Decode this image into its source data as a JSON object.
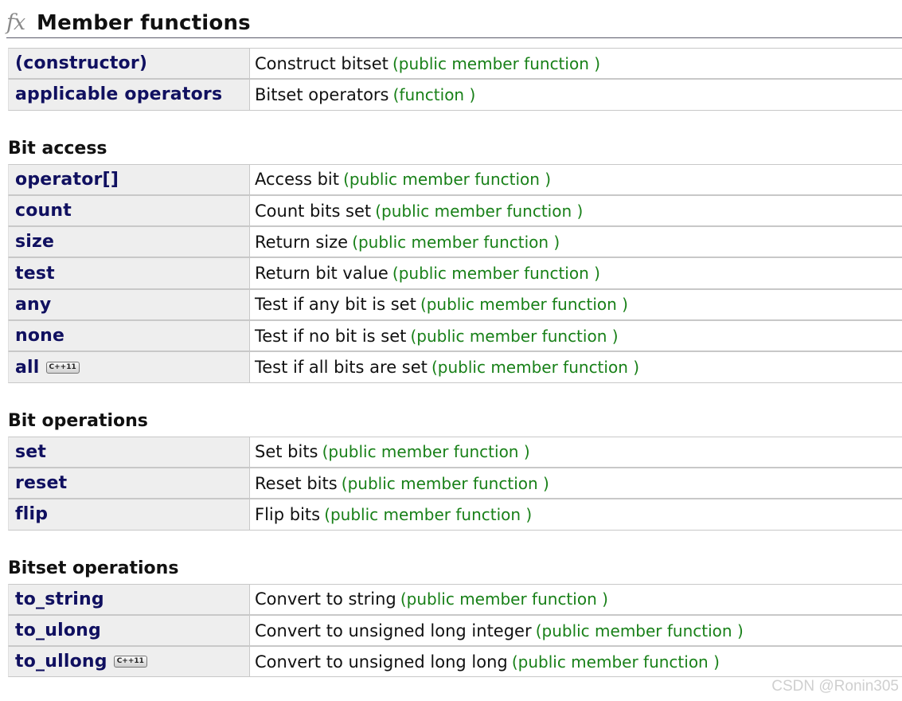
{
  "heading": {
    "icon": "fx",
    "title": "Member functions"
  },
  "sections": [
    {
      "title": "",
      "rows": [
        {
          "name": "(constructor)",
          "desc": "Construct bitset",
          "kind": "(public member function )",
          "badge": ""
        },
        {
          "name": "applicable operators",
          "desc": "Bitset operators",
          "kind": "(function )",
          "badge": ""
        }
      ]
    },
    {
      "title": "Bit access",
      "rows": [
        {
          "name": "operator[]",
          "desc": "Access bit",
          "kind": "(public member function )",
          "badge": ""
        },
        {
          "name": "count",
          "desc": "Count bits set",
          "kind": "(public member function )",
          "badge": ""
        },
        {
          "name": "size",
          "desc": "Return size",
          "kind": "(public member function )",
          "badge": ""
        },
        {
          "name": "test",
          "desc": "Return bit value",
          "kind": "(public member function )",
          "badge": ""
        },
        {
          "name": "any",
          "desc": "Test if any bit is set",
          "kind": "(public member function )",
          "badge": ""
        },
        {
          "name": "none",
          "desc": "Test if no bit is set",
          "kind": "(public member function )",
          "badge": ""
        },
        {
          "name": "all",
          "desc": "Test if all bits are set",
          "kind": "(public member function )",
          "badge": "C++11"
        }
      ]
    },
    {
      "title": "Bit operations",
      "rows": [
        {
          "name": "set",
          "desc": "Set bits",
          "kind": "(public member function )",
          "badge": ""
        },
        {
          "name": "reset",
          "desc": "Reset bits",
          "kind": "(public member function )",
          "badge": ""
        },
        {
          "name": "flip",
          "desc": "Flip bits",
          "kind": "(public member function )",
          "badge": ""
        }
      ]
    },
    {
      "title": "Bitset operations",
      "rows": [
        {
          "name": "to_string",
          "desc": "Convert to string",
          "kind": "(public member function )",
          "badge": ""
        },
        {
          "name": "to_ulong",
          "desc": "Convert to unsigned long integer",
          "kind": "(public member function )",
          "badge": ""
        },
        {
          "name": "to_ullong",
          "desc": "Convert to unsigned long long",
          "kind": "(public member function )",
          "badge": "C++11"
        }
      ]
    }
  ],
  "watermark": "CSDN @Ronin305"
}
